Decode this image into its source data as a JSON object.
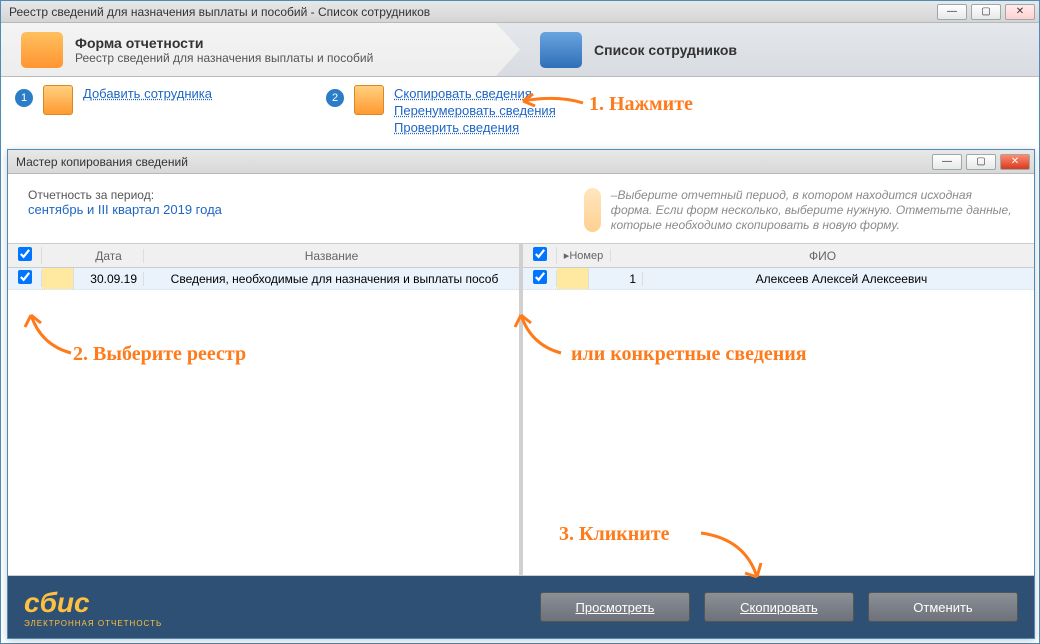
{
  "main_window": {
    "title": "Реестр сведений для назначения выплаты и пособий - Список сотрудников"
  },
  "header": {
    "step1_title": "Форма отчетности",
    "step1_sub": "Реестр сведений для назначения выплаты и пособий",
    "step2_title": "Список сотрудников"
  },
  "toolbar": {
    "badge1": "1",
    "badge2": "2",
    "add_employee": "Добавить сотрудника",
    "copy_data": "Скопировать сведения",
    "renumber_data": "Перенумеровать сведения",
    "check_data": "Проверить сведения"
  },
  "annotations": {
    "step1": "1. Нажмите",
    "step2": "2. Выберите реестр",
    "step2b": "или конкретные сведения",
    "step3": "3. Кликните"
  },
  "wizard": {
    "title": "Мастер копирования сведений",
    "period_label": "Отчетность за период:",
    "period_value": "сентябрь и III квартал 2019 года",
    "hint": "–Выберите отчетный период, в котором находится исходная форма. Если форм несколько, выберите нужную. Отметьте данные, которые необходимо скопировать в новую форму.",
    "left": {
      "col_date": "Дата",
      "col_name": "Название",
      "rows": [
        {
          "date": "30.09.19",
          "name": "Сведения, необходимые для назначения и выплаты пособ"
        }
      ]
    },
    "right": {
      "col_num": "Номер",
      "col_fio": "ФИО",
      "rows": [
        {
          "num": "1",
          "fio": "Алексеев Алексей Алексеевич"
        }
      ]
    },
    "logo": "сбис",
    "logo_sub": "ЭЛЕКТРОННАЯ ОТЧЕТНОСТЬ",
    "btn_preview": "Просмотреть",
    "btn_copy": "Скопировать",
    "btn_cancel": "Отменить"
  }
}
